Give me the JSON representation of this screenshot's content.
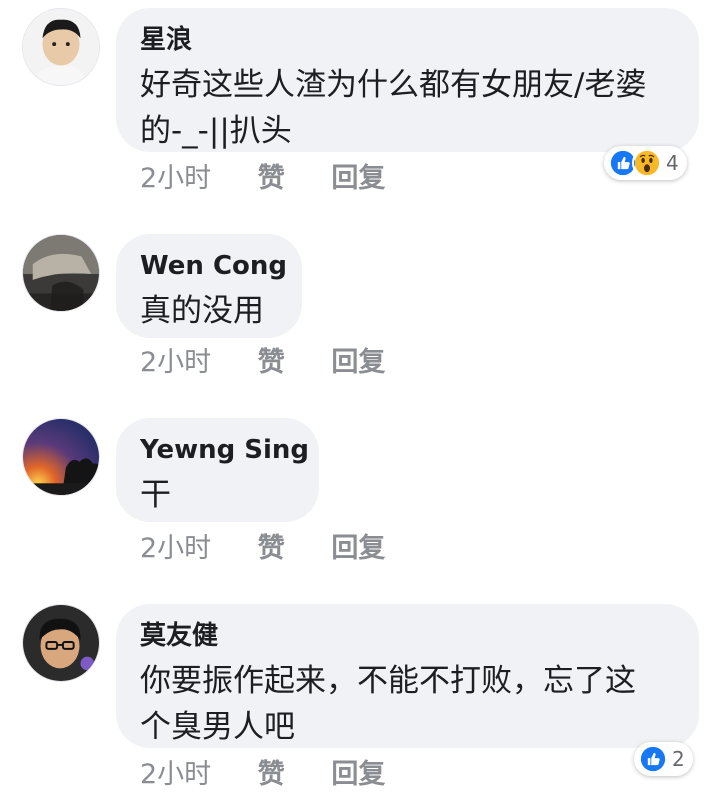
{
  "comments": [
    {
      "author": "星浪",
      "lines": [
        "好奇这些人渣为什么都有女朋友/老婆",
        "的-_-||扒头"
      ],
      "time": "2小时",
      "like_label": "赞",
      "reply_label": "回复",
      "reactions": [
        "like-icon",
        "wow-icon"
      ],
      "reaction_count": "4"
    },
    {
      "author": "Wen Cong",
      "lines": [
        "真的没用"
      ],
      "time": "2小时",
      "like_label": "赞",
      "reply_label": "回复"
    },
    {
      "author": "Yewng Sing",
      "lines": [
        "干"
      ],
      "time": "2小时",
      "like_label": "赞",
      "reply_label": "回复"
    },
    {
      "author": "莫友健",
      "lines": [
        "你要振作起来，不能不打败，忘了这",
        "个臭男人吧"
      ],
      "time": "2小时",
      "like_label": "赞",
      "reply_label": "回复",
      "reactions": [
        "like-icon"
      ],
      "reaction_count": "2"
    }
  ],
  "colors": {
    "bubble_bg": "#f0f2f5",
    "meta_text": "#8a8d91",
    "like_blue": "#1877f2",
    "wow_yellow": "#f7b928"
  }
}
